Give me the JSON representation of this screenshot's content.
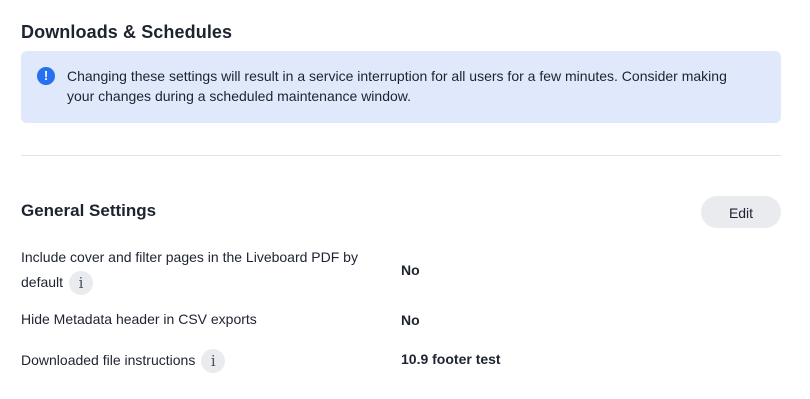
{
  "header": {
    "title": "Downloads & Schedules"
  },
  "banner": {
    "icon": "exclamation-circle-icon",
    "text": "Changing these settings will result in a service interruption for all users for a few minutes. Consider making your changes during a scheduled maintenance window."
  },
  "general": {
    "title": "General Settings",
    "edit_label": "Edit",
    "settings": [
      {
        "label_line1": "Include cover and filter pages in the Liveboard PDF by",
        "label_line2": "default",
        "value": "No"
      },
      {
        "label": "Hide Metadata header in CSV exports",
        "value": "No"
      },
      {
        "label": "Downloaded file instructions",
        "value": "10.9 footer test"
      }
    ]
  },
  "colors": {
    "banner_background": "#e0e8fb",
    "info_accent": "#2770ef",
    "button_background": "#eaebef"
  }
}
